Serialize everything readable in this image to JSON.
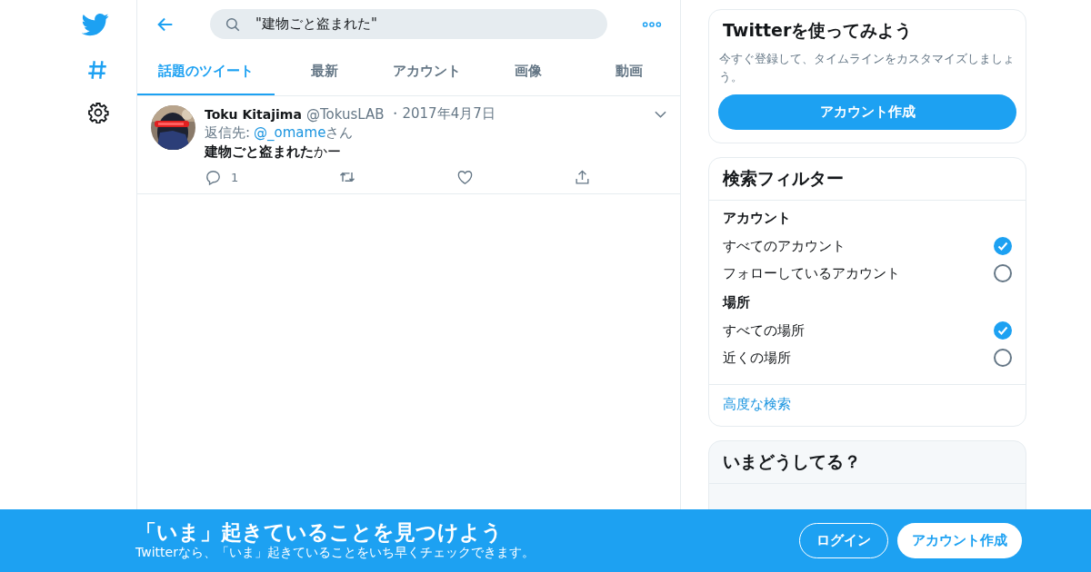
{
  "search": {
    "value": "\"建物ごと盗まれた\""
  },
  "tabs": [
    {
      "label": "話題のツイート",
      "selected": true
    },
    {
      "label": "最新",
      "selected": false
    },
    {
      "label": "アカウント",
      "selected": false
    },
    {
      "label": "画像",
      "selected": false
    },
    {
      "label": "動画",
      "selected": false
    }
  ],
  "tweets": [
    {
      "name": "Toku Kitajima",
      "handle": "@TokusLAB",
      "date": "・2017年4月7日",
      "reply_label": "返信先:",
      "reply_to": "@_omame",
      "reply_suffix": "さん",
      "text": "**建物ごと盗まれた**かー",
      "reply_count": "1"
    }
  ],
  "signup_card": {
    "title": "Twitterを使ってみよう",
    "text": "今すぐ登録して、タイムラインをカスタマイズしましょう。",
    "button": "アカウント作成"
  },
  "filters": {
    "title": "検索フィルター",
    "groups": [
      {
        "heading": "アカウント",
        "options": [
          {
            "label": "すべてのアカウント",
            "selected": true
          },
          {
            "label": "フォローしているアカウント",
            "selected": false
          }
        ]
      },
      {
        "heading": "場所",
        "options": [
          {
            "label": "すべての場所",
            "selected": true
          },
          {
            "label": "近くの場所",
            "selected": false
          }
        ]
      }
    ],
    "link": "高度な検索"
  },
  "trends": {
    "title": "いまどうしてる？"
  },
  "banner": {
    "title": "「いま」起きていることを見つけよう",
    "subtitle": "Twitterなら、「いま」起きていることをいち早くチェックできます。",
    "login": "ログイン",
    "signup": "アカウント作成"
  }
}
